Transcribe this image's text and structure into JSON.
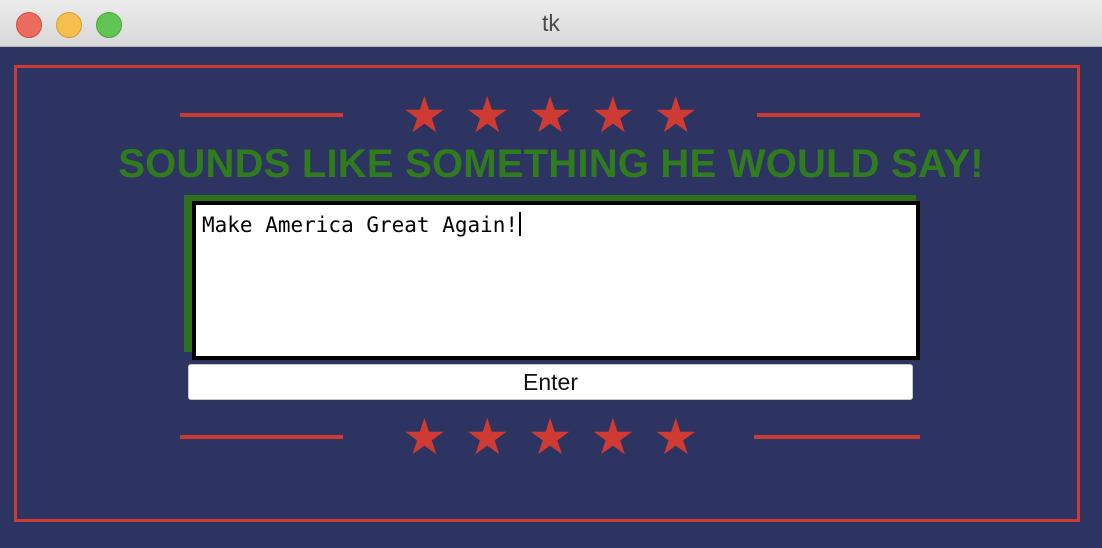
{
  "window": {
    "title": "tk"
  },
  "header": {
    "headline": "SOUNDS LIKE SOMETHING HE WOULD SAY!"
  },
  "input": {
    "value": "Make America Great Again!"
  },
  "button": {
    "label": "Enter"
  },
  "colors": {
    "background": "#2e3461",
    "accent_red": "#c93b33",
    "headline_green": "#2f7b1e"
  },
  "icons": {
    "star": "★"
  }
}
